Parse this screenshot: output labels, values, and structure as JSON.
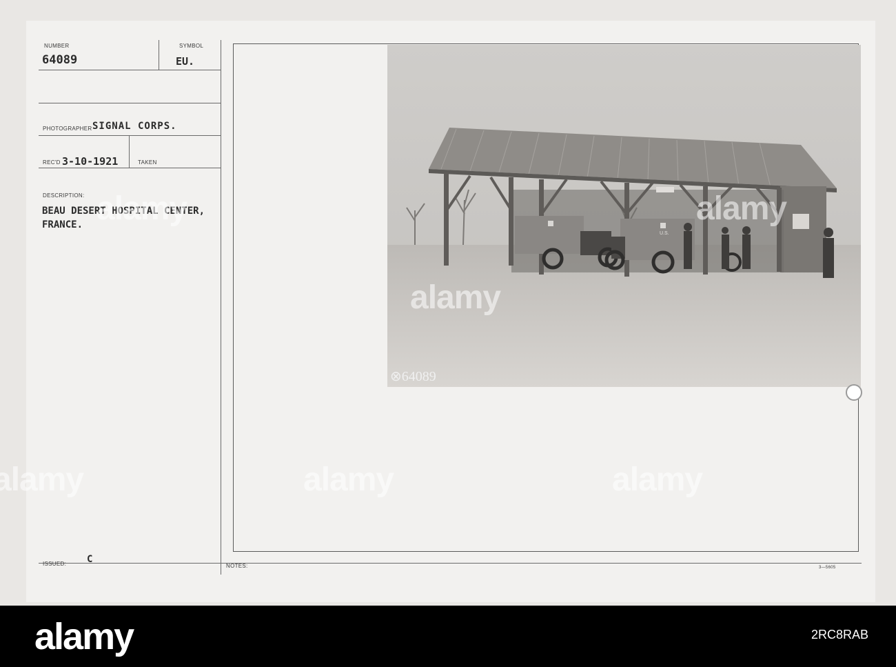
{
  "card": {
    "number_label": "NUMBER",
    "number_value": "64089",
    "symbol_label": "SYMBOL",
    "symbol_value": "EU.",
    "photographer_label": "PHOTOGRAPHER",
    "photographer_value": "SIGNAL CORPS.",
    "recd_label": "REC'D",
    "recd_value": "3-10-1921",
    "taken_label": "TAKEN",
    "description_label": "DESCRIPTION:",
    "description_line1": "BEAU DESERT HOSPITAL CENTER,",
    "description_line2": "FRANCE.",
    "issued_label": "ISSUED:",
    "issued_value": "C",
    "notes_label": "NOTES:",
    "form_code": "3—5605"
  },
  "photo": {
    "negative_number": "⊗64089",
    "vehicle_marking": "U.S."
  },
  "watermark": "alamy",
  "footer": {
    "logo": "alamy",
    "image_id": "2RC8RAB"
  }
}
